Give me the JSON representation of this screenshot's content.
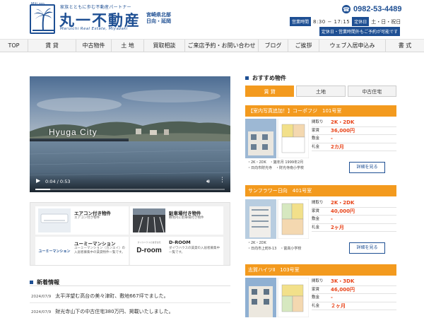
{
  "header": {
    "logo_en": "Miti gro",
    "tagline": "家族とともに歩む不動産パートナー",
    "company": "丸一不動産",
    "pref_line1": "宮崎県北部",
    "pref_line2": "日向・延岡",
    "romaji": "Maruichi Real Estate, Miyazaki",
    "phone": "0982-53-4489",
    "hours_label": "営業時間",
    "hours": "8:30 − 17:15",
    "closed_label": "定休日",
    "closed": "土・日・祝日",
    "notice": "定休日・営業時間外もご予約が可能です"
  },
  "nav": [
    "TOP",
    "賃 貸",
    "中古物件",
    "土 地",
    "買取相談",
    "ご来店予約・お問い合わせ",
    "ブログ",
    "ご挨拶",
    "ウェブ入居申込み",
    "書 式"
  ],
  "video": {
    "title": "Hyuga City",
    "time": "0:04 / 0:53",
    "progress": 0.08
  },
  "banners": [
    {
      "title": "エアコン付き物件",
      "desc": "エアコン付き物件"
    },
    {
      "title": "駐車場付き物件",
      "desc": "敷地内に駐車場付き物件"
    },
    {
      "title": "ユーミーマンション",
      "desc": "ユーミーマンション（カンエイ）の入居者募集中の賃貸物件一覧です。",
      "logo": "ユーミーマンション"
    },
    {
      "title": "D-ROOM",
      "desc": "ダイワハウスの賃貸の入居者募集中一覧です。",
      "logo": "D-room",
      "logo_small": "ダイワハウスの賃貸住宅"
    }
  ],
  "news": {
    "heading": "新着情報",
    "items": [
      {
        "date": "2024/07/9",
        "text": "太平洋望む高台の美々津町、敷地667坪でました。"
      },
      {
        "date": "2024/07/9",
        "text": "財光寺山下の中古住宅380万円、掲載いたしました。"
      }
    ]
  },
  "recommended": {
    "heading": "おすすめ物件",
    "tabs": [
      "賃 貸",
      "土地",
      "中古住宅"
    ],
    "active_tab": 0,
    "detail_label": "詳細を見る",
    "properties": [
      {
        "title": "【室内写真追加！】コーポフジ　101号室",
        "specs": [
          {
            "label": "間取り",
            "value": "2K・2DK"
          },
          {
            "label": "家賃",
            "value": "36,000円"
          },
          {
            "label": "敷金",
            "value": "-"
          },
          {
            "label": "礼金",
            "value": "2カ月"
          }
        ],
        "meta": [
          "・2K・2DK　・築年月 1999年2月",
          "・日向市財光寺　・財光寺南小学校"
        ]
      },
      {
        "title": "サンフラワー日向　401号室",
        "specs": [
          {
            "label": "間取り",
            "value": "2K・2DK"
          },
          {
            "label": "家賃",
            "value": "40,000円"
          },
          {
            "label": "敷金",
            "value": "-"
          },
          {
            "label": "礼金",
            "value": "2ヶ月"
          }
        ],
        "meta": [
          "・2K・2DK",
          "・日向市上町8-13　・富高小学校"
        ]
      },
      {
        "title": "志賀ハイツⅡ　103号室",
        "specs": [
          {
            "label": "間取り",
            "value": "3K・3DK"
          },
          {
            "label": "家賃",
            "value": "46,000円"
          },
          {
            "label": "敷金",
            "value": "-"
          },
          {
            "label": "礼金",
            "value": "２ヶ月"
          }
        ],
        "meta": []
      }
    ]
  },
  "colors": {
    "brand": "#1e4f93",
    "accent": "#f39a1e",
    "price": "#e8441a"
  },
  "icons": [
    "palm-tree-icon",
    "phone-icon",
    "play-icon",
    "volume-icon",
    "more-icon"
  ]
}
